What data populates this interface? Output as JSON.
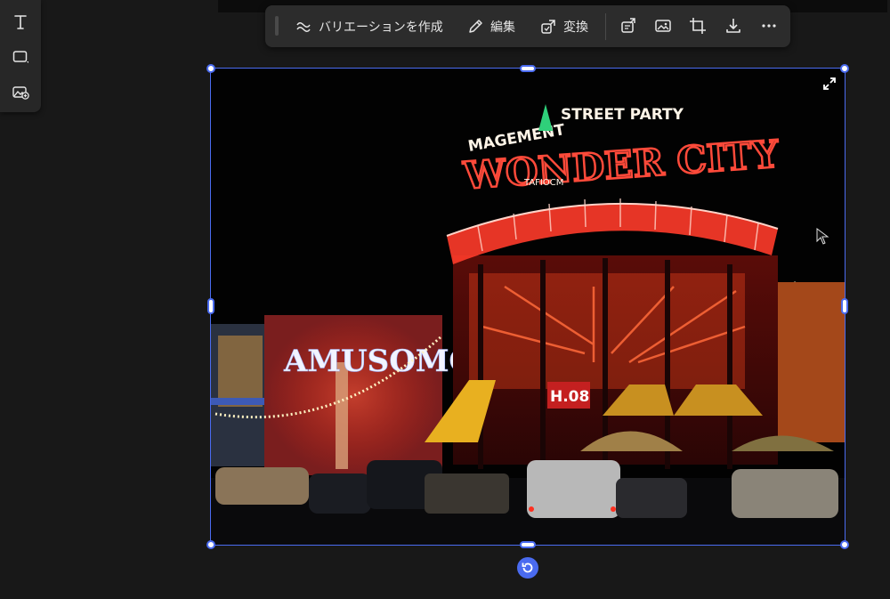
{
  "left_tools": [
    {
      "name": "text-tool",
      "icon": "text-icon"
    },
    {
      "name": "shape-tool",
      "icon": "rectangle-icon"
    },
    {
      "name": "add-image-tool",
      "icon": "add-image-icon"
    }
  ],
  "toolbar": {
    "variation_label": "バリエーションを作成",
    "edit_label": "編集",
    "transform_label": "変換",
    "icons": [
      "remix-icon",
      "image-icon",
      "crop-icon",
      "download-icon",
      "more-icon"
    ]
  },
  "image": {
    "sign_top": "MAGEMENT",
    "sign_party": "STREET PARTY",
    "sign_main": "WONDER CITY",
    "sign_sub": "TAFIOCM",
    "sign_left": "AMUSOMONT",
    "sign_h08": "H.08",
    "colors": {
      "neon_red": "#ff3b2a",
      "neon_pink": "#ffd3c8",
      "neon_white": "#f2f4ff",
      "sky": "#020202"
    }
  },
  "selection_color": "#4a6bf0"
}
